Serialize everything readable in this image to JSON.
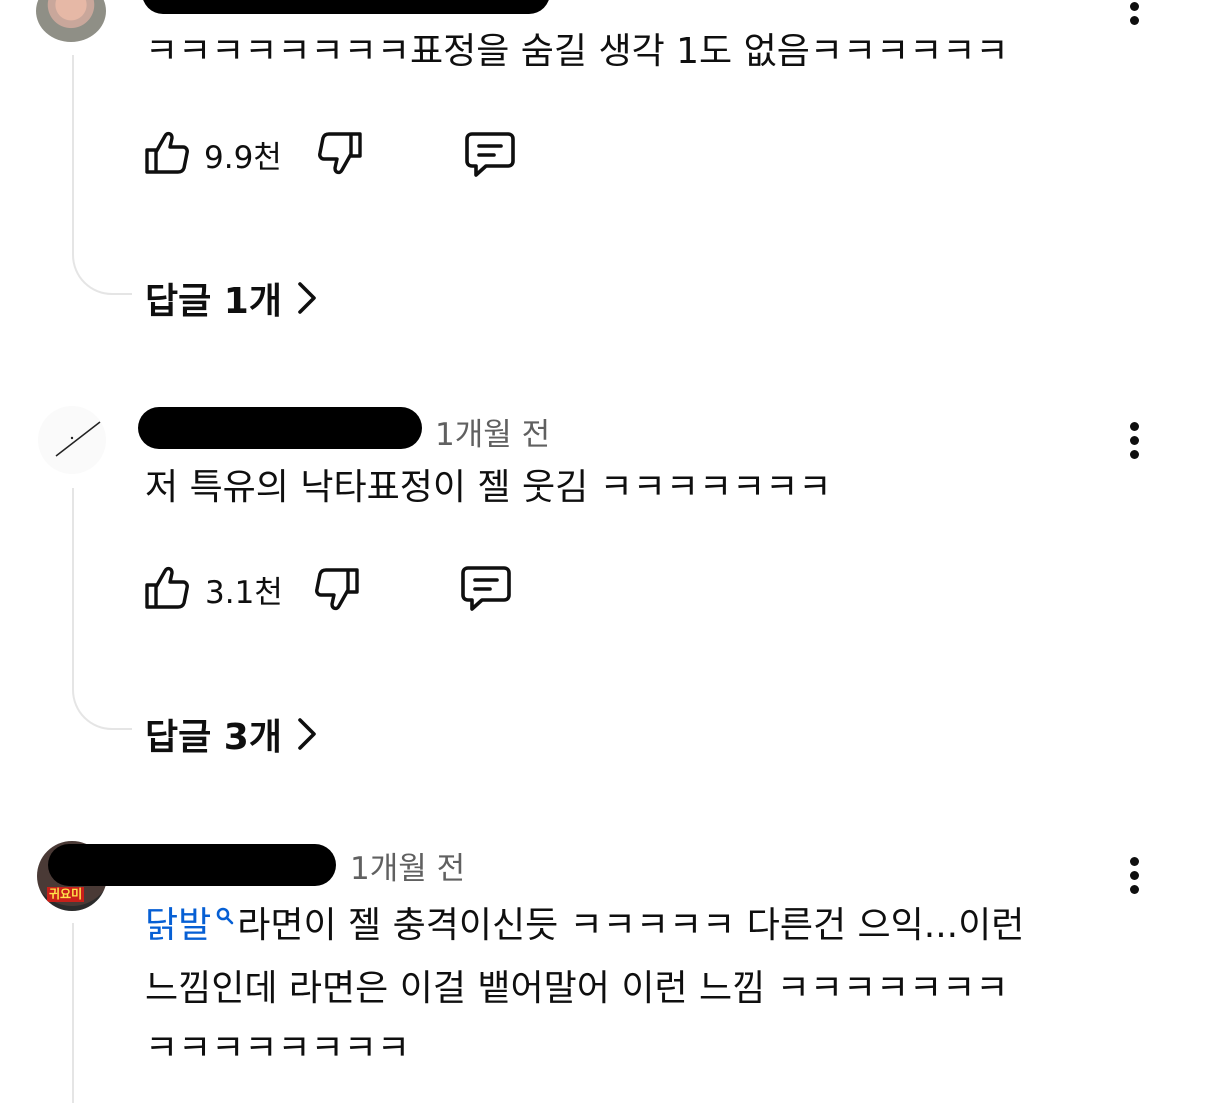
{
  "colors": {
    "text": "#0f0f0f",
    "meta": "#606060",
    "mention": "#065fd4",
    "thread_line": "#e5e5e5",
    "redaction": "#000000"
  },
  "comments": [
    {
      "author": "",
      "time": "",
      "text": "ㅋㅋㅋㅋㅋㅋㅋㅋ표정을 숨길 생각 1도 없음ㅋㅋㅋㅋㅋㅋ",
      "likes": "9.9천",
      "replies_label": "답글 1개"
    },
    {
      "author": "",
      "time": "1개월 전",
      "text": "저 특유의 낙타표정이 젤 웃김 ㅋㅋㅋㅋㅋㅋㅋ",
      "likes": "3.1천",
      "replies_label": "답글 3개"
    },
    {
      "author": "",
      "time": "1개월 전",
      "mention": "닭발",
      "avatar_caption": "귀요미",
      "text_line1": "라면이 젤 충격이신듯 ㅋㅋㅋㅋㅋ 다른건 으익...이런",
      "text_line2": "느낌인데 라면은 이걸 뱉어말어 이런 느낌 ㅋㅋㅋㅋㅋㅋㅋ",
      "text_line3": "ㅋㅋㅋㅋㅋㅋㅋㅋ"
    }
  ],
  "icons": {
    "like": "thumbs-up-icon",
    "dislike": "thumbs-down-icon",
    "reply": "reply-comment-icon",
    "more": "more-vertical-icon",
    "chevron": "chevron-right-icon",
    "search": "search-icon"
  }
}
